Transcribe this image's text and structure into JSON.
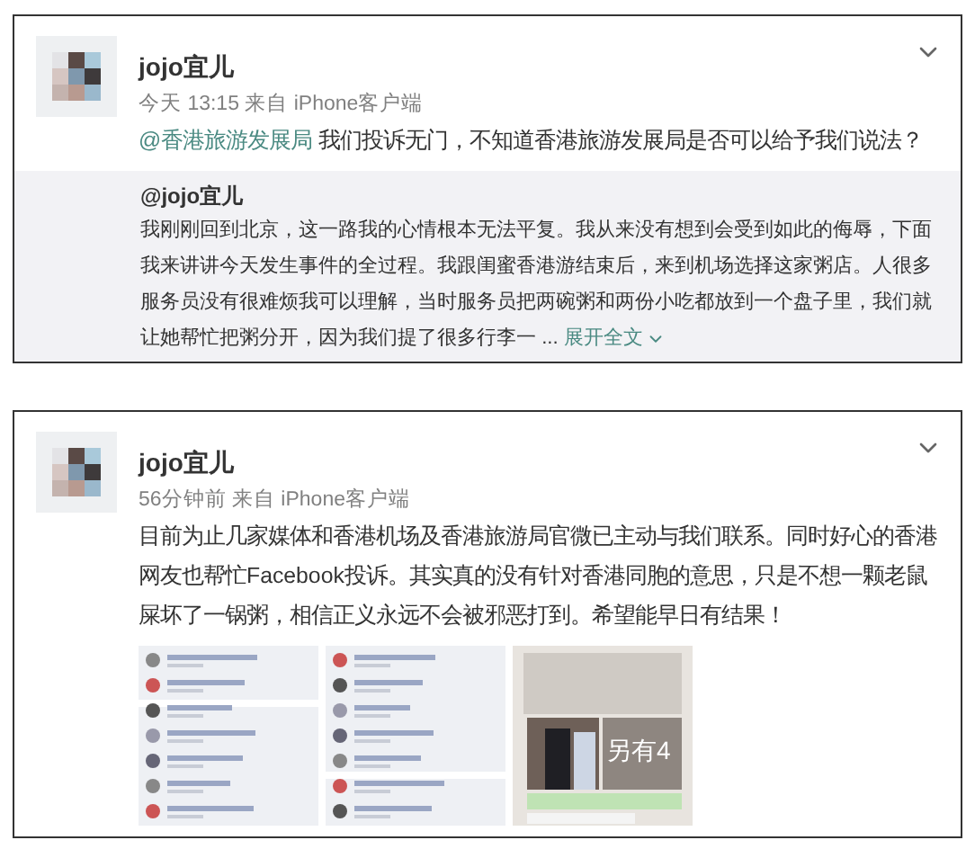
{
  "posts": [
    {
      "author": "jojo宜儿",
      "meta": "今天 13:15 来自 iPhone客户端",
      "mention": "@香港旅游发展局",
      "text": "我们投诉无门，不知道香港旅游发展局是否可以给予我们说法？",
      "quote": {
        "author": "@jojo宜儿",
        "text": "我刚刚回到北京，这一路我的心情根本无法平复。我从来没有想到会受到如此的侮辱，下面我来讲讲今天发生事件的全过程。我跟闺蜜香港游结束后，来到机场选择这家粥店。人很多服务员没有很难烦我可以理解，当时服务员把两碗粥和两份小吃都放到一个盘子里，我们就让她帮忙把粥分开，因为我们提了很多行李一 ...",
        "more": "展开全文"
      }
    },
    {
      "author": "jojo宜儿",
      "meta": "56分钟前 来自 iPhone客户端",
      "text": "目前为止几家媒体和香港机场及香港旅游局官微已主动与我们联系。同时好心的香港网友也帮忙Facebook投诉。其实真的没有针对香港同胞的意思，只是不想一颗老鼠屎坏了一锅粥，相信正义永远不会被邪恶打到。希望能早日有结果！",
      "images": [
        {
          "kind": "picture"
        },
        {
          "kind": "picture"
        },
        {
          "kind": "picture",
          "more": "另有4"
        }
      ]
    }
  ]
}
